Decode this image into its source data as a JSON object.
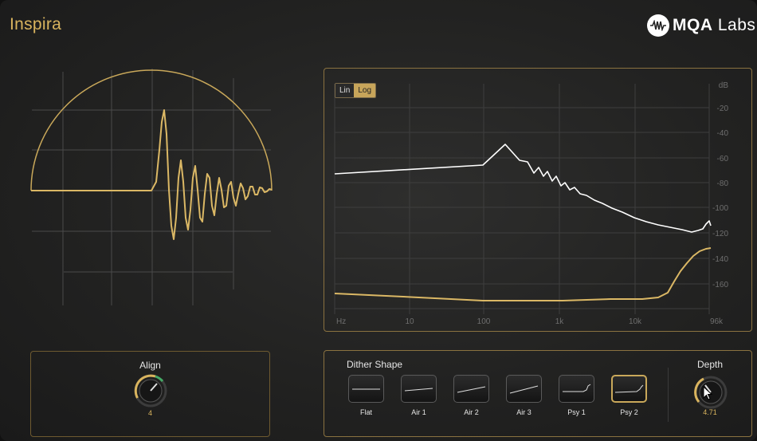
{
  "app": {
    "title": "Inspira"
  },
  "brand": {
    "logo_text_bold": "MQA",
    "logo_text_rest": "Labs"
  },
  "spectrum": {
    "toggle": {
      "lin": "Lin",
      "log": "Log",
      "active": "Log"
    },
    "y_ticks": [
      "dB",
      "-20",
      "-40",
      "-60",
      "-80",
      "-100",
      "-120",
      "-140",
      "-160"
    ],
    "x_ticks": [
      "Hz",
      "10",
      "100",
      "1k",
      "10k",
      "96k"
    ]
  },
  "align": {
    "title": "Align",
    "value": "4"
  },
  "dither": {
    "title": "Dither Shape",
    "shapes": [
      "Flat",
      "Air 1",
      "Air 2",
      "Air 3",
      "Psy 1",
      "Psy 2"
    ],
    "selected": "Psy 2"
  },
  "depth": {
    "title": "Depth",
    "value": "4.71"
  },
  "colors": {
    "accent": "#d9b45e",
    "trace_white": "#ffffff",
    "grid": "#4a4a4a"
  }
}
